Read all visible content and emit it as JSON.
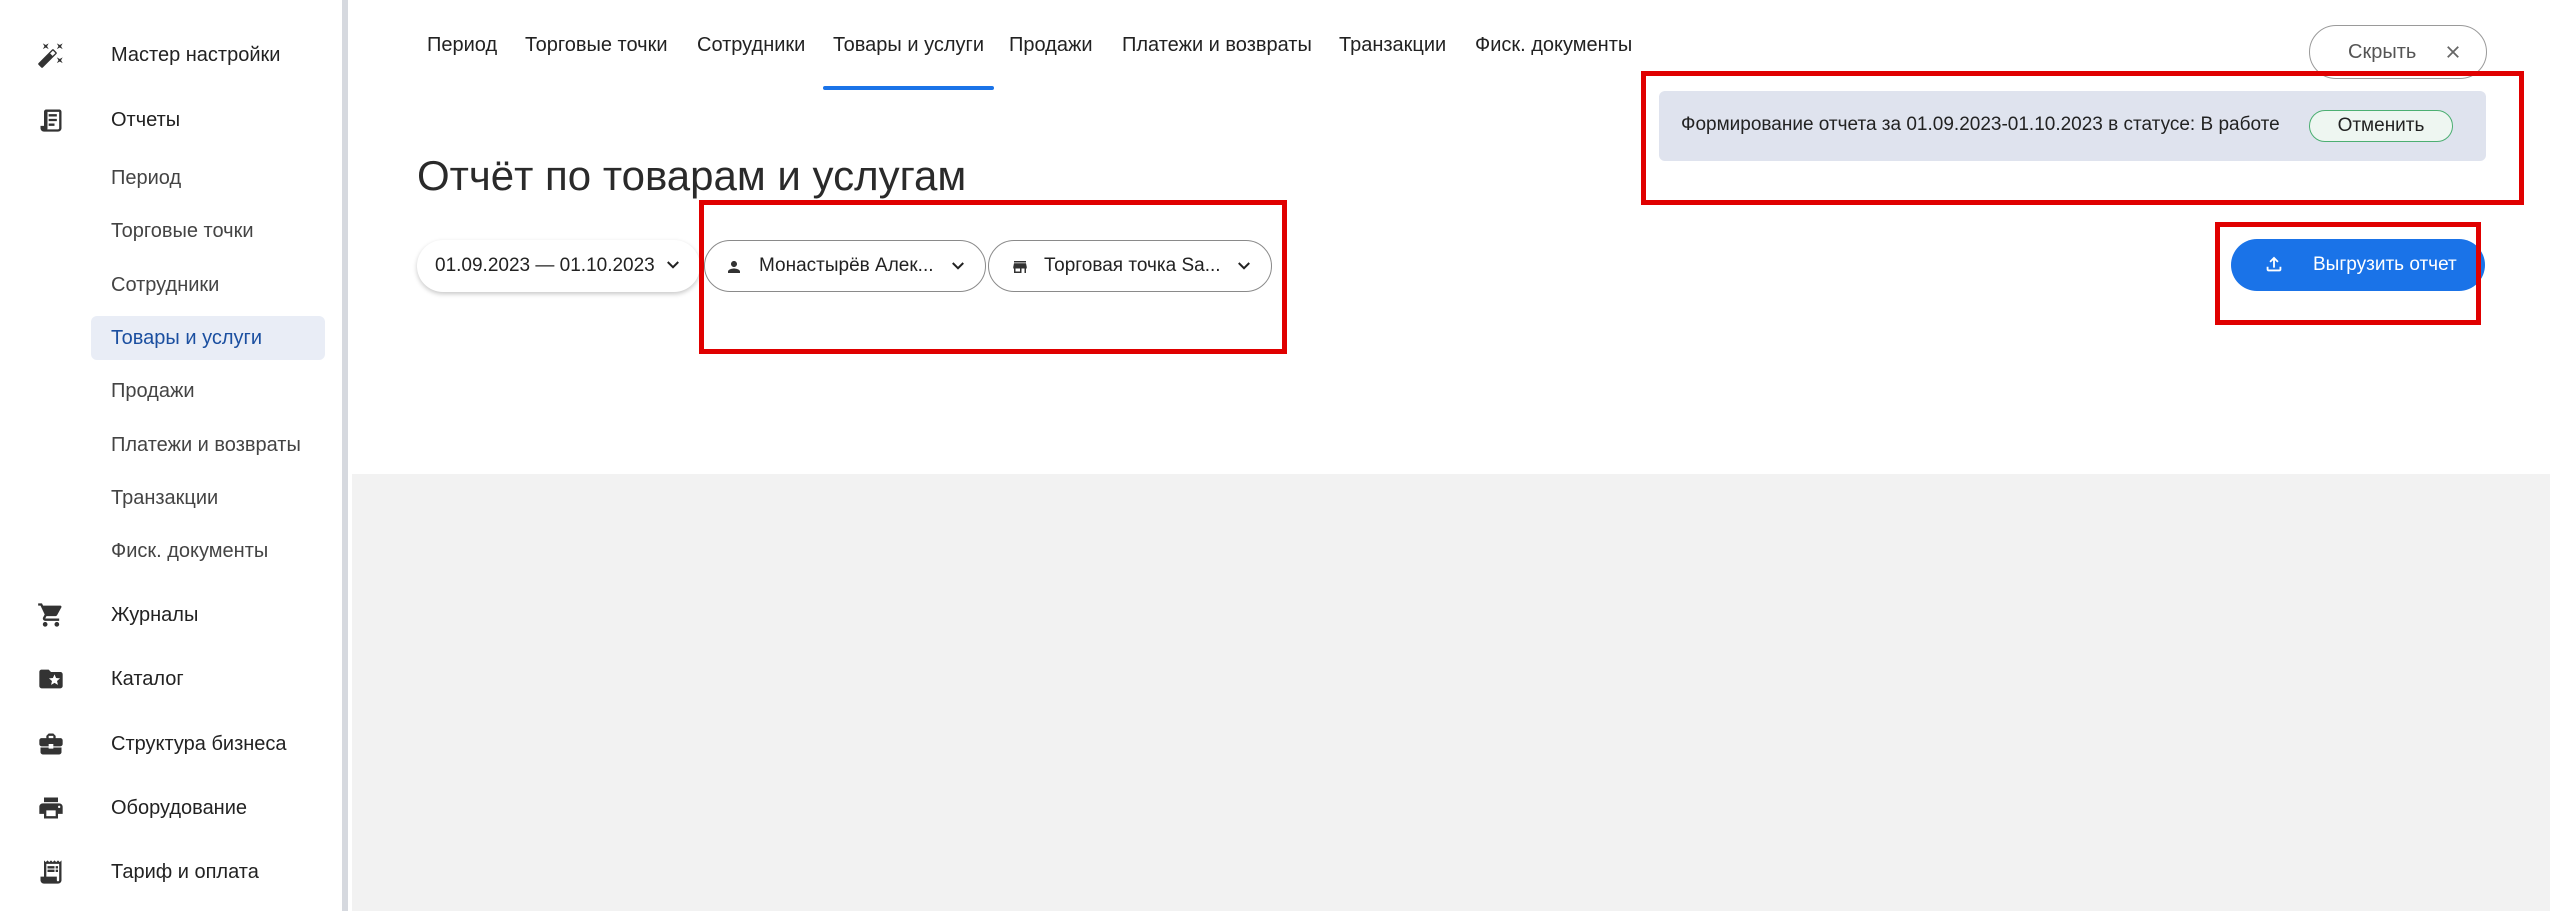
{
  "sidebar": {
    "top_items": [
      {
        "label": "Мастер настройки",
        "icon": "magic-wand-icon"
      },
      {
        "label": "Отчеты",
        "icon": "report-icon"
      }
    ],
    "report_subitems": [
      {
        "label": "Период"
      },
      {
        "label": "Торговые точки"
      },
      {
        "label": "Сотрудники"
      },
      {
        "label": "Товары и услуги",
        "active": true
      },
      {
        "label": "Продажи"
      },
      {
        "label": "Платежи и возвраты"
      },
      {
        "label": "Транзакции"
      },
      {
        "label": "Фиск. документы"
      }
    ],
    "bottom_items": [
      {
        "label": "Журналы",
        "icon": "cart-icon"
      },
      {
        "label": "Каталог",
        "icon": "folder-star-icon"
      },
      {
        "label": "Структура бизнеса",
        "icon": "briefcase-icon"
      },
      {
        "label": "Оборудование",
        "icon": "printer-icon"
      },
      {
        "label": "Тариф и оплата",
        "icon": "receipt-icon"
      }
    ]
  },
  "tabs": [
    {
      "label": "Период"
    },
    {
      "label": "Торговые точки"
    },
    {
      "label": "Сотрудники"
    },
    {
      "label": "Товары и услуги",
      "active": true
    },
    {
      "label": "Продажи"
    },
    {
      "label": "Платежи и возвраты"
    },
    {
      "label": "Транзакции"
    },
    {
      "label": "Фиск. документы"
    }
  ],
  "page_title": "Отчёт по товарам и услугам",
  "filters": {
    "date_range": "01.09.2023 — 01.10.2023",
    "employee": "Монастырёв Алек...",
    "store": "Торговая точка Sa..."
  },
  "hide_button": {
    "label": "Скрыть"
  },
  "banner": {
    "text": "Формирование отчета за 01.09.2023-01.10.2023 в статусе: В работе",
    "cancel_label": "Отменить"
  },
  "export_button": {
    "label": "Выгрузить отчет"
  },
  "colors": {
    "accent": "#1a73e8",
    "active_nav_bg": "#e9edf6",
    "banner_bg": "#dfe3ee",
    "annotation_red": "#e00000"
  }
}
